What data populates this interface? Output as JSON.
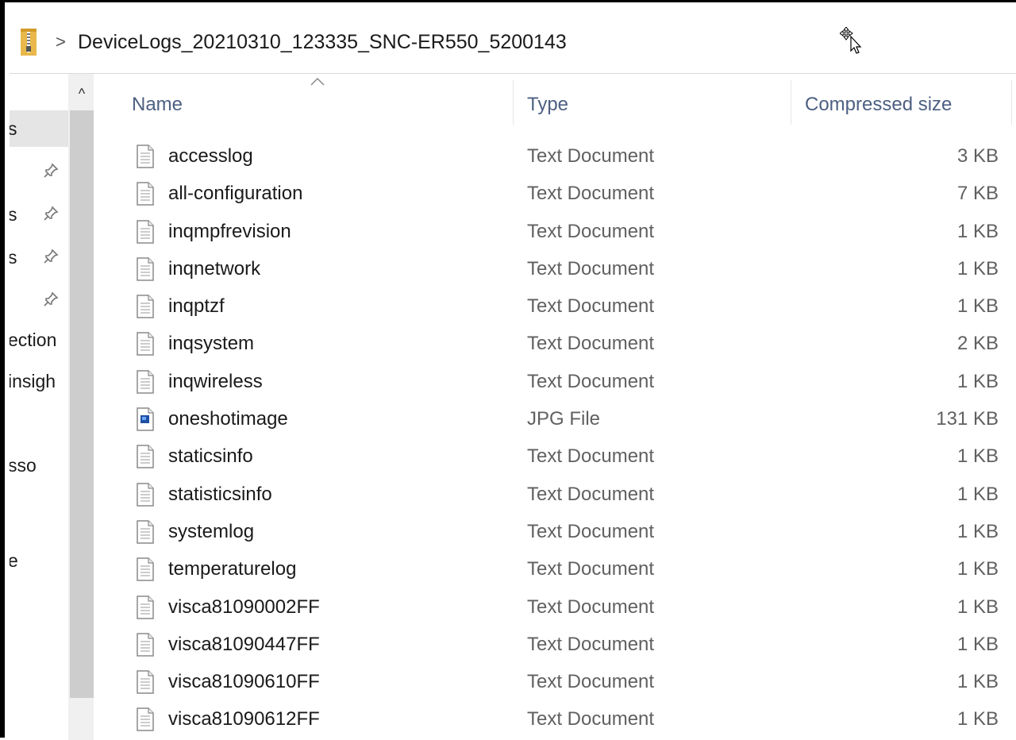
{
  "address_bar": {
    "separator": ">",
    "path": "DeviceLogs_20210310_123335_SNC-ER550_5200143",
    "folder_icon": "zip-folder-icon",
    "cursor_icon": "move-cursor-icon"
  },
  "nav_pane": {
    "items": [
      {
        "label": "s",
        "pinned": false
      },
      {
        "label": "",
        "pinned": true
      },
      {
        "label": "s",
        "pinned": true
      },
      {
        "label": "s",
        "pinned": true
      },
      {
        "label": "",
        "pinned": true
      },
      {
        "label": "ection",
        "pinned": false
      },
      {
        "label": "insigh",
        "pinned": false
      },
      {
        "label": "sso",
        "pinned": false
      },
      {
        "label": "e",
        "pinned": false
      }
    ],
    "scroll_up": "^"
  },
  "columns": {
    "name": "Name",
    "type": "Type",
    "compressed_size": "Compressed size"
  },
  "files": [
    {
      "name": "accesslog",
      "type": "Text Document",
      "size": "3 KB",
      "icon": "text-file-icon"
    },
    {
      "name": "all-configuration",
      "type": "Text Document",
      "size": "7 KB",
      "icon": "text-file-icon"
    },
    {
      "name": "inqmpfrevision",
      "type": "Text Document",
      "size": "1 KB",
      "icon": "text-file-icon"
    },
    {
      "name": "inqnetwork",
      "type": "Text Document",
      "size": "1 KB",
      "icon": "text-file-icon"
    },
    {
      "name": "inqptzf",
      "type": "Text Document",
      "size": "1 KB",
      "icon": "text-file-icon"
    },
    {
      "name": "inqsystem",
      "type": "Text Document",
      "size": "2 KB",
      "icon": "text-file-icon"
    },
    {
      "name": "inqwireless",
      "type": "Text Document",
      "size": "1 KB",
      "icon": "text-file-icon"
    },
    {
      "name": "oneshotimage",
      "type": "JPG File",
      "size": "131 KB",
      "icon": "image-file-icon"
    },
    {
      "name": "staticsinfo",
      "type": "Text Document",
      "size": "1 KB",
      "icon": "text-file-icon"
    },
    {
      "name": "statisticsinfo",
      "type": "Text Document",
      "size": "1 KB",
      "icon": "text-file-icon"
    },
    {
      "name": "systemlog",
      "type": "Text Document",
      "size": "1 KB",
      "icon": "text-file-icon"
    },
    {
      "name": "temperaturelog",
      "type": "Text Document",
      "size": "1 KB",
      "icon": "text-file-icon"
    },
    {
      "name": "visca81090002FF",
      "type": "Text Document",
      "size": "1 KB",
      "icon": "text-file-icon"
    },
    {
      "name": "visca81090447FF",
      "type": "Text Document",
      "size": "1 KB",
      "icon": "text-file-icon"
    },
    {
      "name": "visca81090610FF",
      "type": "Text Document",
      "size": "1 KB",
      "icon": "text-file-icon"
    },
    {
      "name": "visca81090612FF",
      "type": "Text Document",
      "size": "1 KB",
      "icon": "text-file-icon"
    }
  ],
  "colors": {
    "header_text": "#4d6082",
    "secondary_text": "#606060",
    "selected_bg": "#e5e5e5"
  }
}
